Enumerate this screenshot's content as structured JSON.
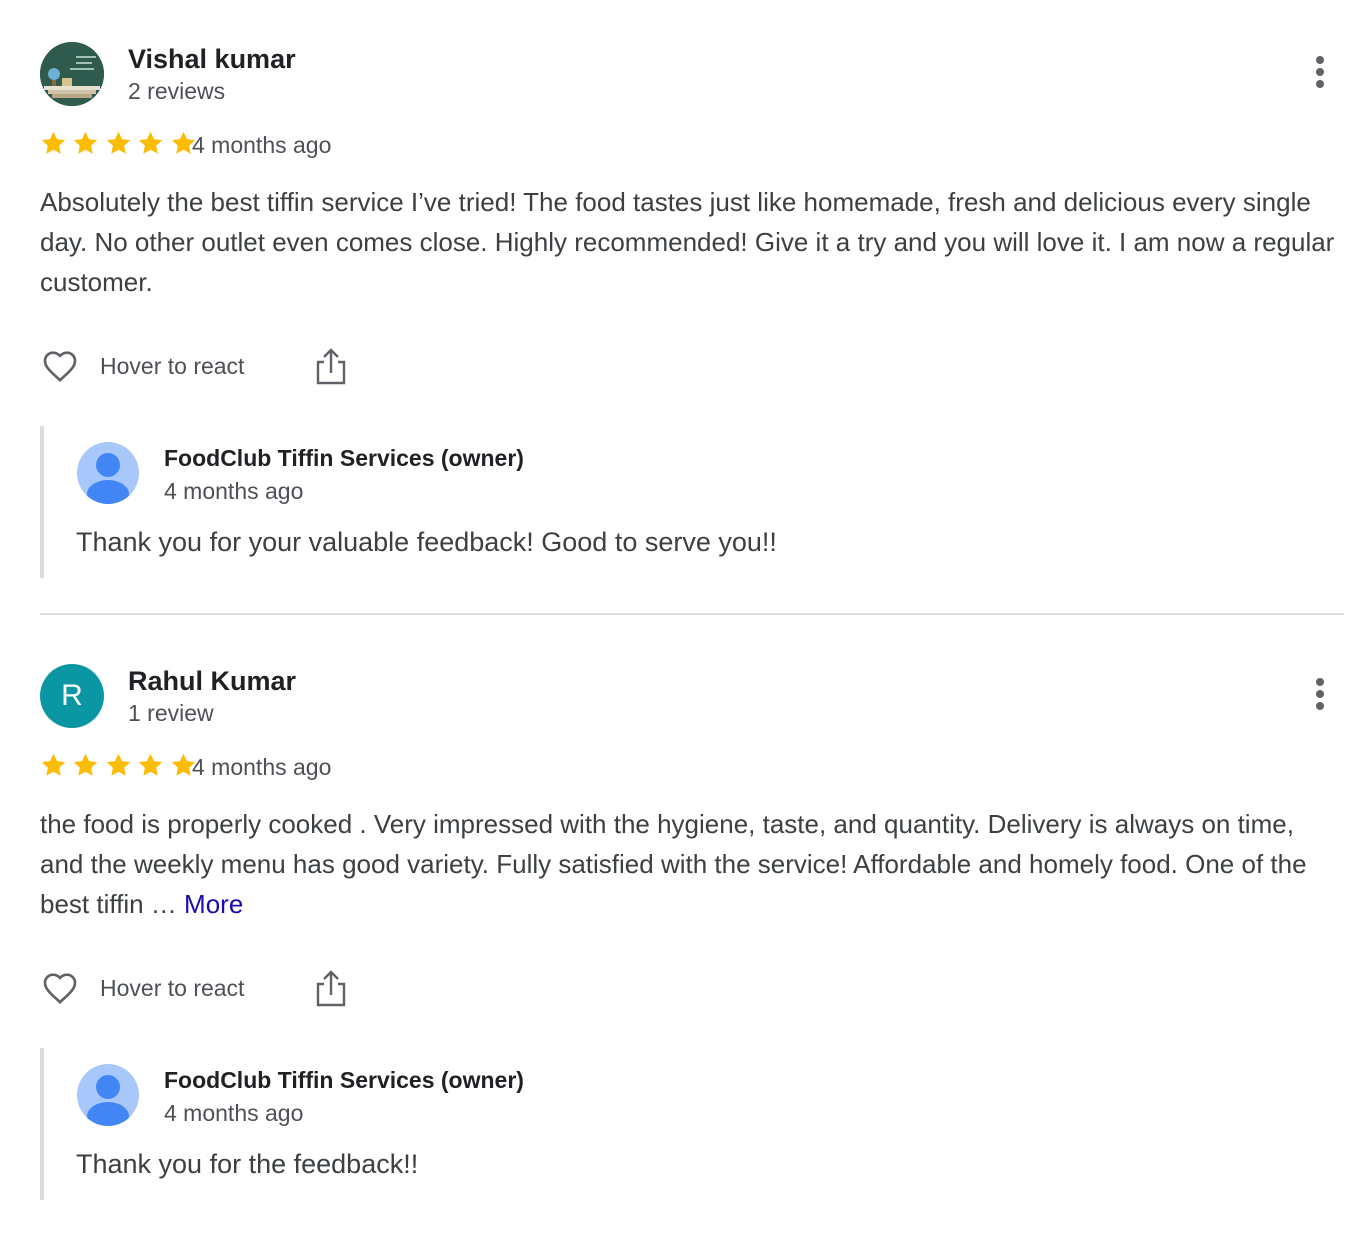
{
  "reviews": [
    {
      "reviewer_name": "Vishal kumar",
      "review_count": "2 reviews",
      "avatar": "photo-avatar",
      "rating": 5,
      "time": "4 months ago",
      "text": "Absolutely the best tiffin service I’ve tried! The food tastes just like homemade, fresh and delicious every single day. No other outlet even comes close. Highly recommended! Give it a try and you will love it. I am now a regular customer.",
      "more_link": "",
      "react_label": "Hover to react",
      "owner_reply": {
        "name": "FoodClub Tiffin Services (owner)",
        "time": "4 months ago",
        "text": "Thank you for your valuable feedback! Good to serve you!!"
      }
    },
    {
      "reviewer_name": "Rahul Kumar",
      "review_count": "1 review",
      "avatar_letter": "R",
      "rating": 5,
      "time": "4 months ago",
      "text": "the food is properly cooked . Very impressed with the hygiene, taste, and quantity. Delivery is always on time, and the weekly menu has good variety. Fully satisfied with the service! Affordable and homely food. One of the best tiffin …",
      "more_link": "More",
      "react_label": "Hover to react",
      "owner_reply": {
        "name": "FoodClub Tiffin Services (owner)",
        "time": "4 months ago",
        "text": "Thank you for the feedback!!"
      }
    }
  ],
  "colors": {
    "star": "#fbbc04",
    "letter_avatar": "#0b96a3",
    "link": "#1a0dab",
    "owner_avatar_bg": "#a8c7fa",
    "owner_avatar_fg": "#4285f4"
  },
  "icons": [
    "more-vert-icon",
    "star-icon",
    "heart-icon",
    "share-icon",
    "person-icon"
  ]
}
